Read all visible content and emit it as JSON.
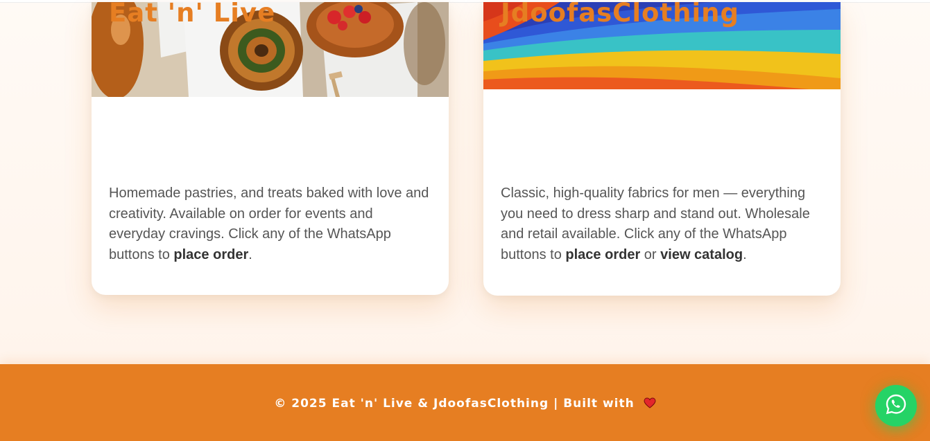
{
  "cards": [
    {
      "title": "Eat 'n' Live",
      "desc_before": "Homemade pastries, and treats baked with love and creativity. Available on order for events and everyday cravings. Click any of the WhatsApp buttons to ",
      "desc_strong_1": "place order",
      "desc_after": "."
    },
    {
      "title": "JdoofasClothing",
      "desc_before": "Classic, high-quality fabrics for men — everything you need to dress sharp and stand out. Wholesale and retail available. Click any of the WhatsApp buttons to ",
      "desc_strong_1": "place order",
      "desc_mid": " or ",
      "desc_strong_2": "view catalog",
      "desc_after": "."
    }
  ],
  "footer": {
    "text": "© 2025 Eat 'n' Live & JdoofasClothing | Built with"
  },
  "icons": {
    "heart": "heart-icon",
    "whatsapp": "whatsapp-icon"
  },
  "colors": {
    "accent": "#e67e22",
    "whatsapp": "#25d366",
    "heart": "#e3262b"
  }
}
